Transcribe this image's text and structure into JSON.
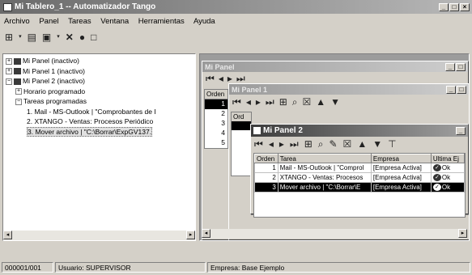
{
  "app": {
    "title": "Mi Tablero_1 -- Automatizador Tango"
  },
  "menu": [
    "Archivo",
    "Panel",
    "Tareas",
    "Ventana",
    "Herramientas",
    "Ayuda"
  ],
  "tree": {
    "items": [
      {
        "label": "Mi Panel (inactivo)"
      },
      {
        "label": "Mi Panel 1 (inactivo)"
      },
      {
        "label": "Mi Panel 2 (inactivo)"
      },
      {
        "label": "Horario programado"
      },
      {
        "label": "Tareas programadas"
      },
      {
        "label": "1. Mail - MS-Outlook | \"Comprobantes de I"
      },
      {
        "label": "2. XTANGO - Ventas: Procesos Periódico"
      },
      {
        "label": "3. Mover archivo | \"C:\\Borrar\\ExpGV137."
      }
    ]
  },
  "windows": {
    "panel": {
      "title": "Mi Panel",
      "col_orden": "Orden",
      "rows": [
        "1",
        "2",
        "3",
        "4",
        "5"
      ]
    },
    "panel1": {
      "title": "Mi Panel 1",
      "col_orden": "Ord"
    },
    "panel2": {
      "title": "Mi Panel 2",
      "columns": [
        "Orden",
        "Tarea",
        "Empresa",
        "Ultima Ej"
      ],
      "rows": [
        {
          "orden": "1",
          "tarea": "Mail - MS-Outlook | \"Comprol",
          "empresa": "[Empresa Activa]",
          "ultima": "Ok"
        },
        {
          "orden": "2",
          "tarea": "XTANGO - Ventas: Procesos",
          "empresa": "[Empresa Activa]",
          "ultima": "Ok"
        },
        {
          "orden": "3",
          "tarea": "Mover archivo | \"C:\\Borrar\\E",
          "empresa": "[Empresa Activa]",
          "ultima": "Ok"
        }
      ]
    }
  },
  "status": {
    "counter": "000001/001",
    "user": "Usuario: SUPERVISOR",
    "empresa": "Empresa: Base Ejemplo"
  }
}
